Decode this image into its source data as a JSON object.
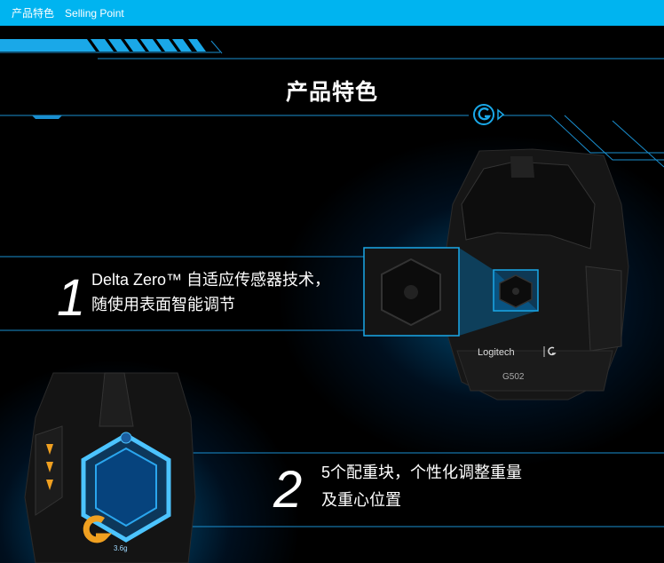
{
  "topbar": {
    "title_cn": "产品特色",
    "title_en": "Selling Point"
  },
  "section_title": "产品特色",
  "features": [
    {
      "number": "1",
      "line1": "Delta Zero™ 自适应传感器技术，",
      "line2": "随使用表面智能调节"
    },
    {
      "number": "2",
      "line1": "5个配重块，个性化调整重量",
      "line2": "及重心位置"
    }
  ],
  "mouse": {
    "brand": "Logitech",
    "model": "G502"
  },
  "weights": {
    "label": "3.6g"
  },
  "colors": {
    "topbar": "#00b4f0",
    "accent": "#1aa8e8",
    "background": "#000000",
    "logo_orange": "#f0a020"
  }
}
